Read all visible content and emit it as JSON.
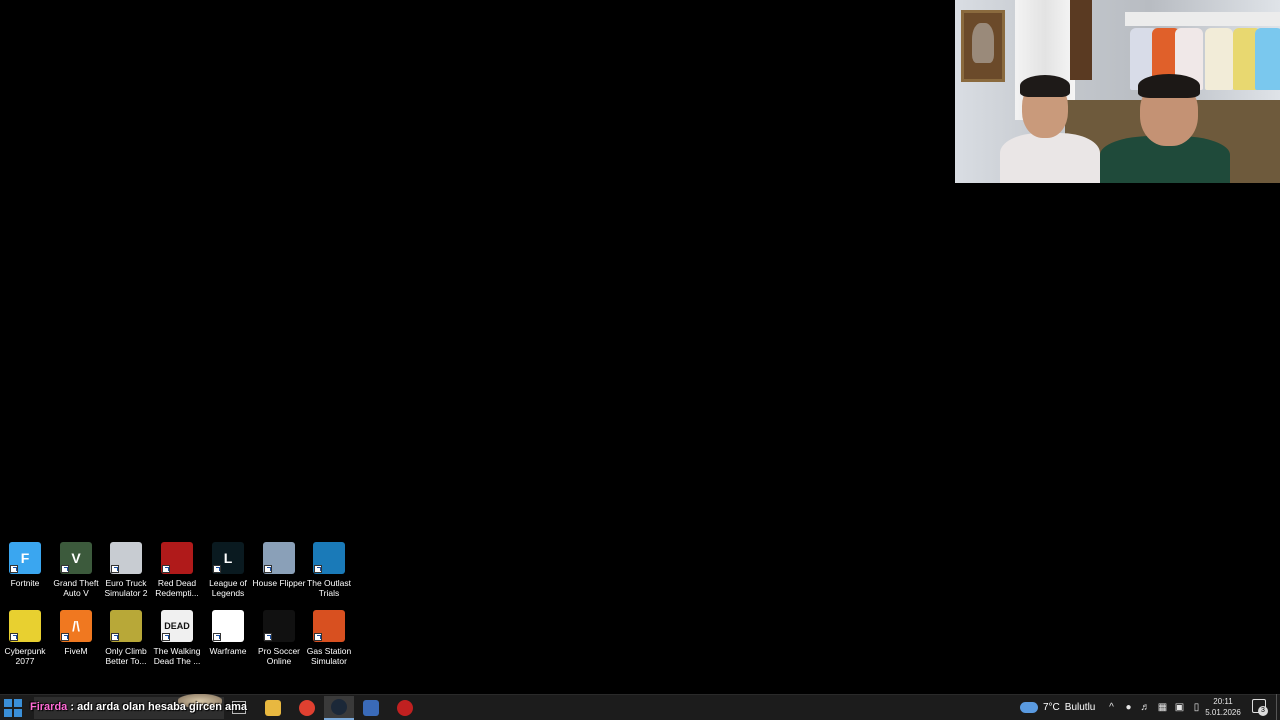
{
  "desktop": {
    "icons": [
      {
        "label": "Fortnite",
        "icon": "fortnite-icon",
        "color": "#3aa6f0",
        "glyph": "F"
      },
      {
        "label": "Grand Theft Auto V",
        "icon": "gta-v-icon",
        "color": "#3c5a3c",
        "glyph": "V"
      },
      {
        "label": "Euro Truck Simulator 2",
        "icon": "euro-truck-icon",
        "color": "#c8ccd2",
        "glyph": ""
      },
      {
        "label": "Red Dead Redempti...",
        "icon": "red-dead-icon",
        "color": "#b01a1a",
        "glyph": ""
      },
      {
        "label": "League of Legends",
        "icon": "league-icon",
        "color": "#0a1a20",
        "glyph": "L"
      },
      {
        "label": "House Flipper",
        "icon": "house-flipper-icon",
        "color": "#8aa0b8",
        "glyph": ""
      },
      {
        "label": "The Outlast Trials",
        "icon": "outlast-icon",
        "color": "#1a7ab8",
        "glyph": ""
      },
      {
        "label": "Cyberpunk 2077",
        "icon": "cyberpunk-icon",
        "color": "#e8d030",
        "glyph": ""
      },
      {
        "label": "FiveM",
        "icon": "fivem-icon",
        "color": "#f07820",
        "glyph": "/\\"
      },
      {
        "label": "Only Climb Better To...",
        "icon": "only-climb-icon",
        "color": "#b8a838",
        "glyph": ""
      },
      {
        "label": "The Walking Dead The ...",
        "icon": "walking-dead-icon",
        "color": "#f0f0f0",
        "glyph": "DEAD"
      },
      {
        "label": "Warframe",
        "icon": "warframe-icon",
        "color": "#ffffff",
        "glyph": ""
      },
      {
        "label": "Pro Soccer Online",
        "icon": "pro-soccer-icon",
        "color": "#111111",
        "glyph": ""
      },
      {
        "label": "Gas Station Simulator",
        "icon": "gas-station-icon",
        "color": "#d85020",
        "glyph": ""
      }
    ]
  },
  "chat": {
    "username": "Firarda",
    "separator": ":",
    "message": "adı arda olan hesaba gircen ama"
  },
  "taskbar": {
    "apps": [
      {
        "name": "file-explorer",
        "color": "#e8b840"
      },
      {
        "name": "chrome",
        "color": "#e04030"
      },
      {
        "name": "steam",
        "color": "#1b2838",
        "active": true
      },
      {
        "name": "remote-desktop",
        "color": "#3a6ab8"
      },
      {
        "name": "obs",
        "color": "#c02020"
      }
    ],
    "weather": {
      "temp": "7°C",
      "condition": "Bulutlu"
    },
    "clock": {
      "time": "20:11",
      "date": "5.01.2026"
    },
    "notification_count": "3"
  }
}
